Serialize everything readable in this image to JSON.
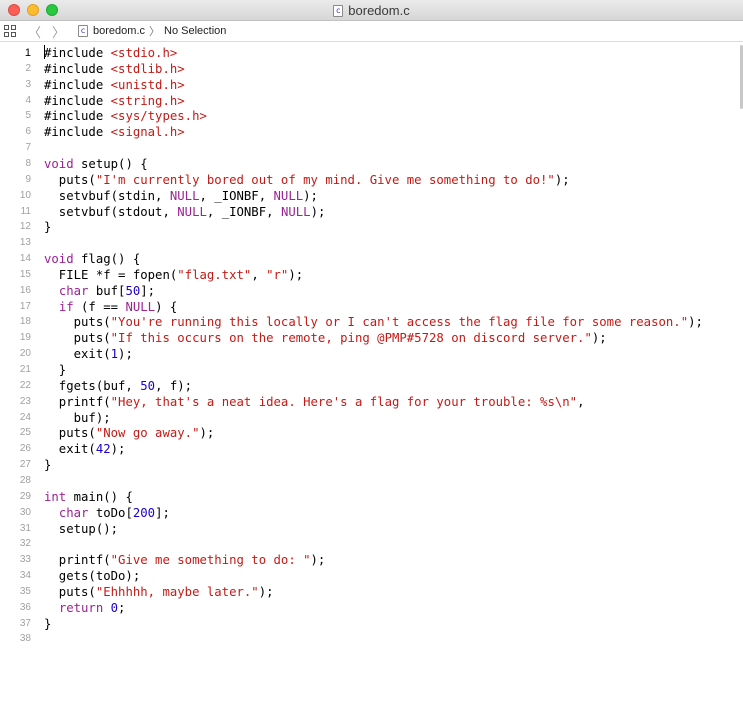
{
  "window": {
    "title": "boredom.c",
    "file_icon_glyph": "c"
  },
  "jumpbar": {
    "file_label": "boredom.c",
    "separator": "〉",
    "selection_label": "No Selection",
    "back_glyph": "〈",
    "forward_glyph": "〉"
  },
  "editor": {
    "current_line": 1,
    "lines": [
      [
        [
          "#include ",
          "p"
        ],
        [
          "<stdio.h>",
          "str"
        ]
      ],
      [
        [
          "#include ",
          "p"
        ],
        [
          "<stdlib.h>",
          "str"
        ]
      ],
      [
        [
          "#include ",
          "p"
        ],
        [
          "<unistd.h>",
          "str"
        ]
      ],
      [
        [
          "#include ",
          "p"
        ],
        [
          "<string.h>",
          "str"
        ]
      ],
      [
        [
          "#include ",
          "p"
        ],
        [
          "<sys/types.h>",
          "str"
        ]
      ],
      [
        [
          "#include ",
          "p"
        ],
        [
          "<signal.h>",
          "str"
        ]
      ],
      [],
      [
        [
          "void",
          "kw"
        ],
        [
          " setup() {",
          "p"
        ]
      ],
      [
        [
          "  puts(",
          "p"
        ],
        [
          "\"I'm currently bored out of my mind. Give me something to do!\"",
          "str"
        ],
        [
          ");",
          "p"
        ]
      ],
      [
        [
          "  setvbuf(stdin, ",
          "p"
        ],
        [
          "NULL",
          "kw"
        ],
        [
          ", _IONBF, ",
          "p"
        ],
        [
          "NULL",
          "kw"
        ],
        [
          ");",
          "p"
        ]
      ],
      [
        [
          "  setvbuf(stdout, ",
          "p"
        ],
        [
          "NULL",
          "kw"
        ],
        [
          ", _IONBF, ",
          "p"
        ],
        [
          "NULL",
          "kw"
        ],
        [
          ");",
          "p"
        ]
      ],
      [
        [
          "}",
          "p"
        ]
      ],
      [],
      [
        [
          "void",
          "kw"
        ],
        [
          " flag() {",
          "p"
        ]
      ],
      [
        [
          "  FILE *f = fopen(",
          "p"
        ],
        [
          "\"flag.txt\"",
          "str"
        ],
        [
          ", ",
          "p"
        ],
        [
          "\"r\"",
          "str"
        ],
        [
          ");",
          "p"
        ]
      ],
      [
        [
          "  ",
          "p"
        ],
        [
          "char",
          "kw"
        ],
        [
          " buf[",
          "p"
        ],
        [
          "50",
          "num"
        ],
        [
          "];",
          "p"
        ]
      ],
      [
        [
          "  ",
          "p"
        ],
        [
          "if",
          "kw"
        ],
        [
          " (f == ",
          "p"
        ],
        [
          "NULL",
          "kw"
        ],
        [
          ") {",
          "p"
        ]
      ],
      [
        [
          "    puts(",
          "p"
        ],
        [
          "\"You're running this locally or I can't access the flag file for some reason.\"",
          "str"
        ],
        [
          ");",
          "p"
        ]
      ],
      [
        [
          "    puts(",
          "p"
        ],
        [
          "\"If this occurs on the remote, ping @PMP#5728 on discord server.\"",
          "str"
        ],
        [
          ");",
          "p"
        ]
      ],
      [
        [
          "    exit(",
          "p"
        ],
        [
          "1",
          "num"
        ],
        [
          ");",
          "p"
        ]
      ],
      [
        [
          "  }",
          "p"
        ]
      ],
      [
        [
          "  fgets(buf, ",
          "p"
        ],
        [
          "50",
          "num"
        ],
        [
          ", f);",
          "p"
        ]
      ],
      [
        [
          "  printf(",
          "p"
        ],
        [
          "\"Hey, that's a neat idea. Here's a flag for your trouble: %s\\n\"",
          "str"
        ],
        [
          ",",
          "p"
        ]
      ],
      [
        [
          "    buf);",
          "p"
        ]
      ],
      [
        [
          "  puts(",
          "p"
        ],
        [
          "\"Now go away.\"",
          "str"
        ],
        [
          ");",
          "p"
        ]
      ],
      [
        [
          "  exit(",
          "p"
        ],
        [
          "42",
          "num"
        ],
        [
          ");",
          "p"
        ]
      ],
      [
        [
          "}",
          "p"
        ]
      ],
      [],
      [
        [
          "int",
          "kw"
        ],
        [
          " main() {",
          "p"
        ]
      ],
      [
        [
          "  ",
          "p"
        ],
        [
          "char",
          "kw"
        ],
        [
          " toDo[",
          "p"
        ],
        [
          "200",
          "num"
        ],
        [
          "];",
          "p"
        ]
      ],
      [
        [
          "  setup();",
          "p"
        ]
      ],
      [],
      [
        [
          "  printf(",
          "p"
        ],
        [
          "\"Give me something to do: \"",
          "str"
        ],
        [
          ");",
          "p"
        ]
      ],
      [
        [
          "  gets(toDo);",
          "p"
        ]
      ],
      [
        [
          "  puts(",
          "p"
        ],
        [
          "\"Ehhhhh, maybe later.\"",
          "str"
        ],
        [
          ");",
          "p"
        ]
      ],
      [
        [
          "  ",
          "p"
        ],
        [
          "return",
          "kw"
        ],
        [
          " ",
          "p"
        ],
        [
          "0",
          "num"
        ],
        [
          ";",
          "p"
        ]
      ],
      [
        [
          "}",
          "p"
        ]
      ],
      []
    ]
  },
  "colors": {
    "keyword": "#9b2393",
    "string": "#c41a16",
    "number": "#1c00cf",
    "plain": "#000000",
    "line_number": "#a0a0a0"
  }
}
